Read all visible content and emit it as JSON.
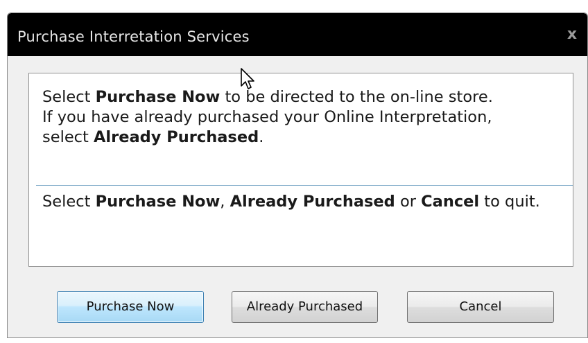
{
  "dialog": {
    "title": "Purchase Interretation Services",
    "close_label": "x"
  },
  "message": {
    "line1_pre": "Select ",
    "line1_bold": "Purchase Now",
    "line1_post": " to be directed to the on-line store.",
    "line2": "If you have already purchased your Online Interpretation,",
    "line3_pre": "select ",
    "line3_bold": "Already Purchased",
    "line3_post": "."
  },
  "instruction": {
    "pre": "Select ",
    "bold1": "Purchase Now",
    "sep1": ", ",
    "bold2": "Already Purchased",
    "sep2": " or ",
    "bold3": "Cancel",
    "post": " to quit."
  },
  "buttons": {
    "purchase_now": "Purchase Now",
    "already_purchased": "Already Purchased",
    "cancel": "Cancel"
  },
  "colors": {
    "titlebar_bg": "#000000",
    "title_text": "#e6e6e6",
    "dialog_bg": "#f0f0f0",
    "panel_bg": "#ffffff",
    "divider": "#7aa7c7",
    "primary_button_border": "#3c7fb1"
  },
  "icons": {
    "close": "close-icon",
    "cursor": "mouse-pointer-icon"
  }
}
